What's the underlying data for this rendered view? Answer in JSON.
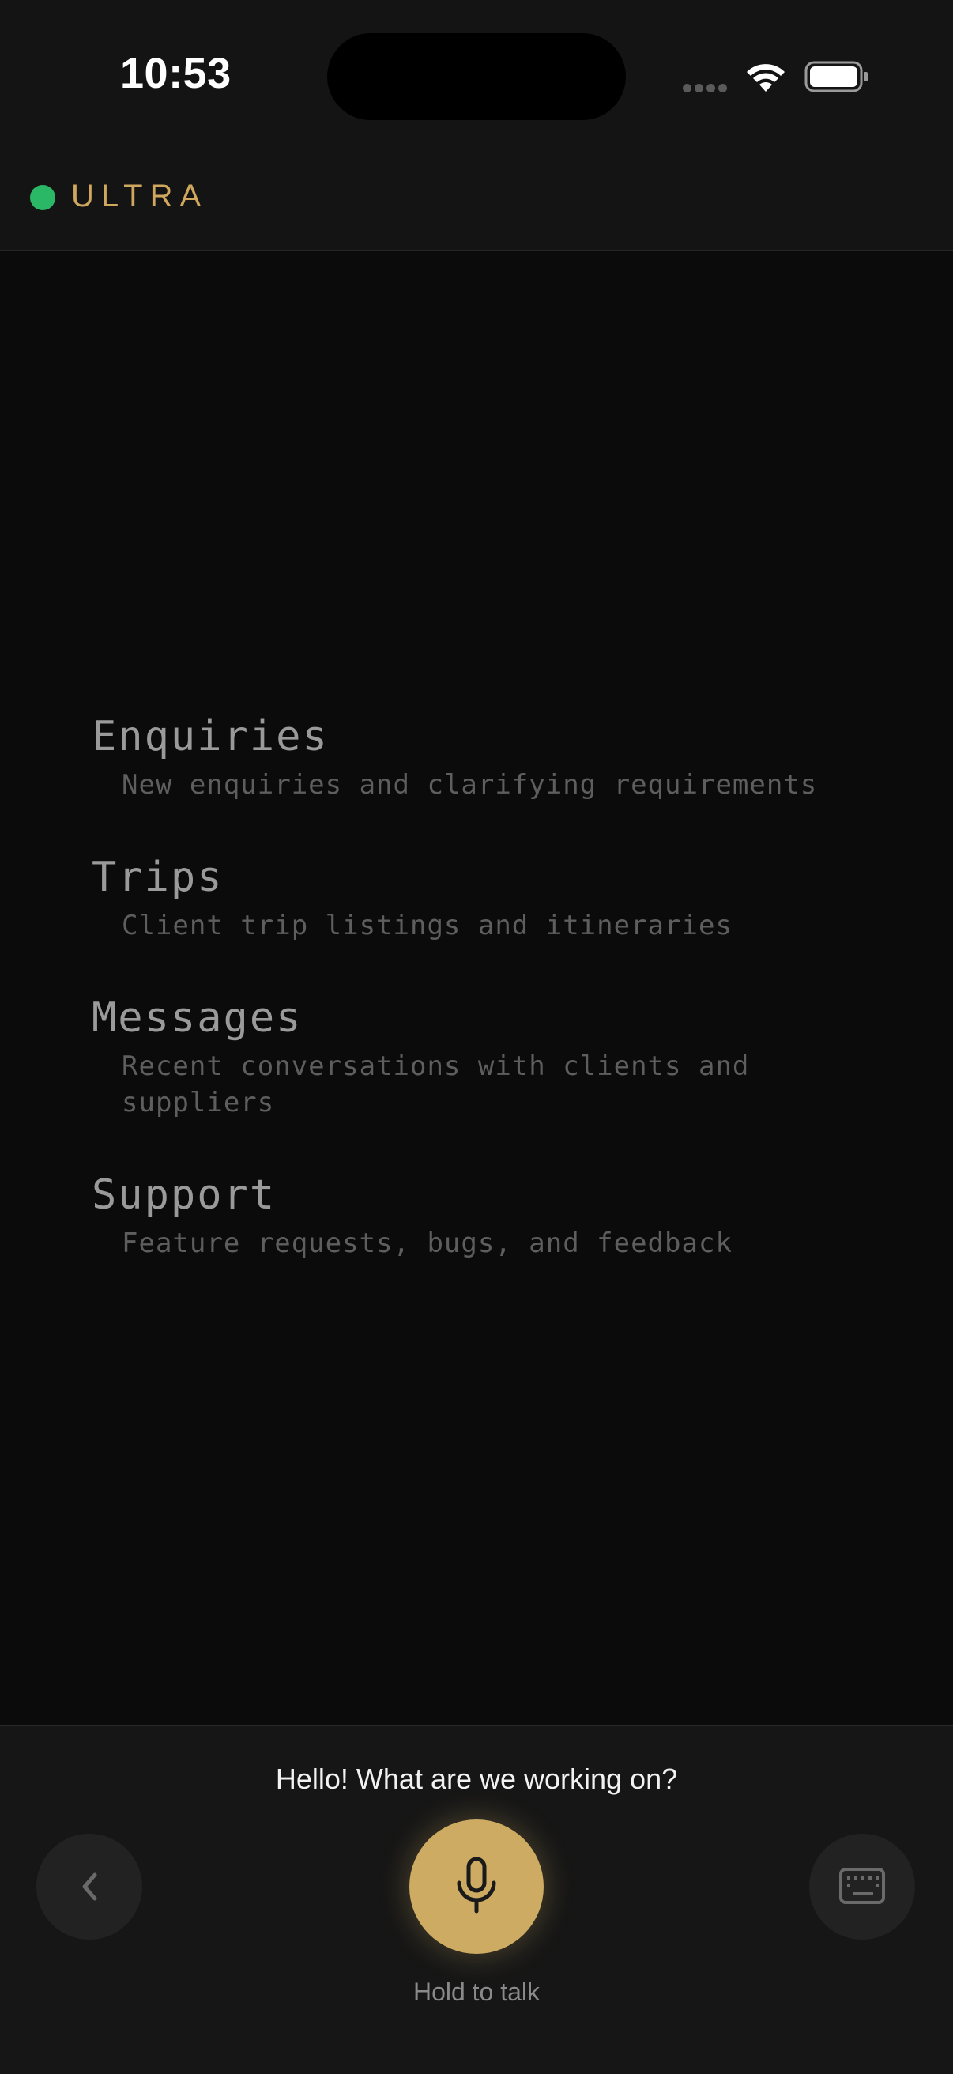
{
  "status_bar": {
    "time": "10:53"
  },
  "brand": {
    "name": "ULTRA",
    "status_color": "#2bb866",
    "accent_color": "#cfa85e"
  },
  "menu": {
    "items": [
      {
        "title": "Enquiries",
        "description": "New enquiries and clarifying requirements"
      },
      {
        "title": "Trips",
        "description": "Client trip listings and itineraries"
      },
      {
        "title": "Messages",
        "description": "Recent conversations with clients and suppliers"
      },
      {
        "title": "Support",
        "description": "Feature requests, bugs, and feedback"
      }
    ]
  },
  "assistant": {
    "greeting": "Hello! What are we working on?",
    "mic_label": "Hold to talk",
    "mic_color": "#cdab62",
    "back_icon": "chevron-left-icon",
    "keyboard_icon": "keyboard-icon",
    "mic_icon": "microphone-icon"
  }
}
